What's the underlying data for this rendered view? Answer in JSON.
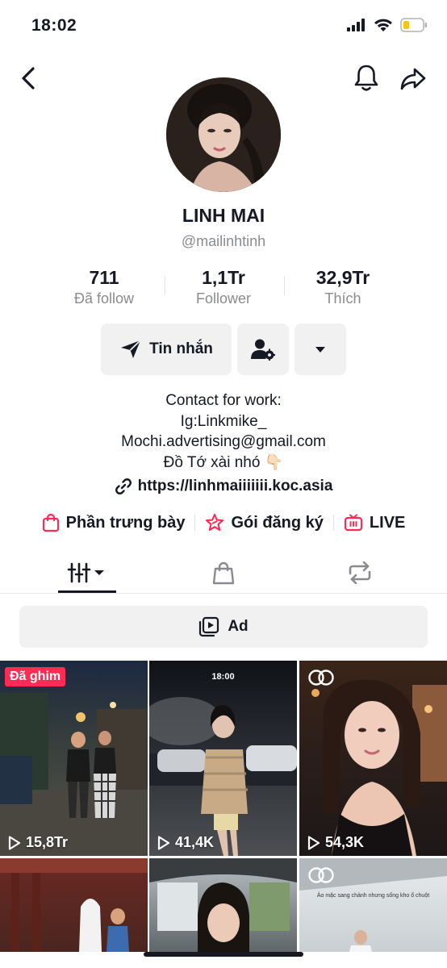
{
  "status_bar": {
    "time": "18:02"
  },
  "profile": {
    "display_name": "LINH MAI",
    "username": "@mailinhtinh"
  },
  "stats": [
    {
      "value": "711",
      "label": "Đã follow"
    },
    {
      "value": "1,1Tr",
      "label": "Follower"
    },
    {
      "value": "32,9Tr",
      "label": "Thích"
    }
  ],
  "actions": {
    "message_label": "Tin nhắn"
  },
  "bio": {
    "lines": [
      "Contact for work:",
      "Ig:Linkmike_",
      "Mochi.advertising@gmail.com",
      "Đồ Tớ xài nhó 👇🏻"
    ],
    "link": "https://linhmaiiiiiii.koc.asia"
  },
  "features": [
    {
      "label": "Phần trưng bày",
      "icon": "shopping-bag-icon"
    },
    {
      "label": "Gói đăng ký",
      "icon": "star-badge-icon"
    },
    {
      "label": "LIVE",
      "icon": "live-tv-icon"
    }
  ],
  "ad_bar": {
    "label": "Ad"
  },
  "videos": [
    {
      "views": "15,8Tr",
      "pinned_label": "Đã ghim"
    },
    {
      "views": "41,4K",
      "time_overlay": "18:00"
    },
    {
      "views": "54,3K"
    },
    {
      "views": ""
    },
    {
      "views": ""
    },
    {
      "views": "",
      "caption": "Ảo mặc sang chảnh nhưng sống kho ổ chuột"
    }
  ],
  "colors": {
    "accent": "#fe2c55",
    "text": "#161823",
    "muted": "#8a8b91",
    "button_bg": "#f1f1f2"
  }
}
